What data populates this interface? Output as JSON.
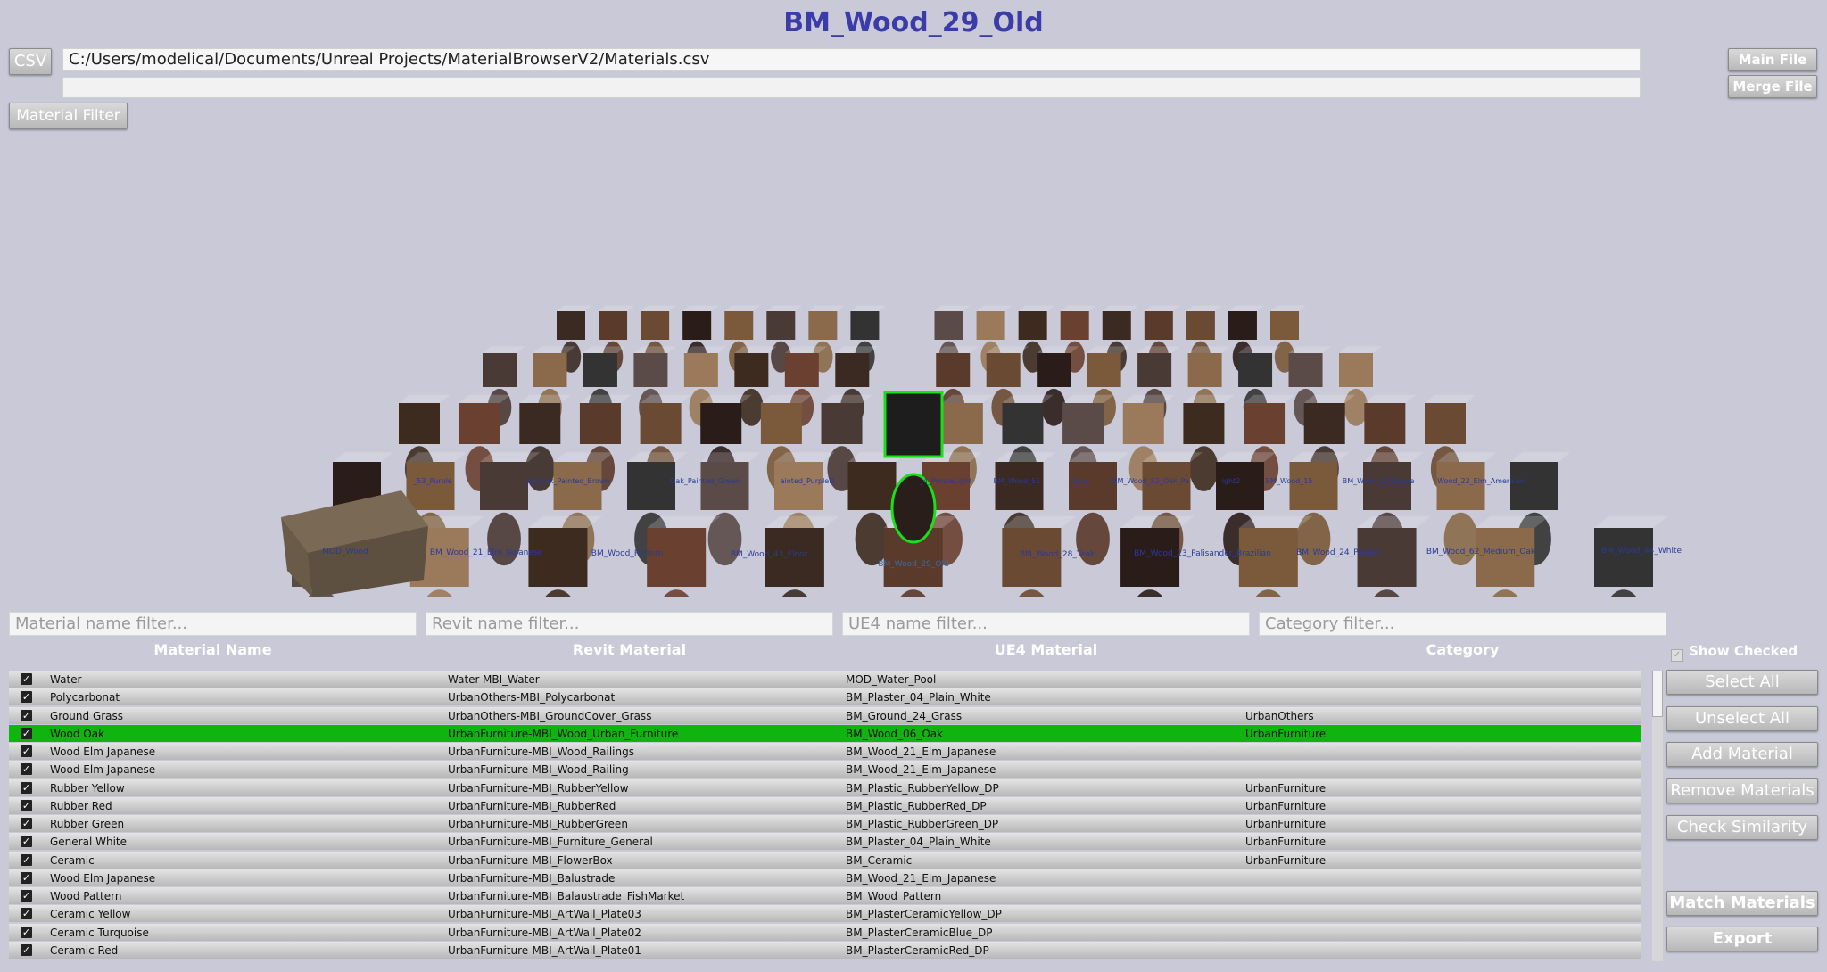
{
  "header": {
    "title": "BM_Wood_29_Old"
  },
  "top": {
    "csv_label": "CSV",
    "csv_path": "C:/Users/modelical/Documents/Unreal Projects/MaterialBrowserV2/Materials.csv",
    "main_file": "Main File",
    "merge_file": "Merge File",
    "material_filter": "Material Filter"
  },
  "viewport": {
    "labels": [
      "MOD_Wood",
      "BM_Wood_21_Elm_Japanese",
      "BM_Wood_Pattern",
      "BM_Wood_43_Floor",
      "BM_Wood_29_Old",
      "BM_Wood_28_Teak",
      "BM_Wood_23_Palisander_Brazilian",
      "BM_Wood_24_Paldao",
      "BM_Wood_62_Medium_Oak",
      "BM_Wood_44_White"
    ],
    "labels_row2": [
      "_53_Purple",
      "_50_Oak_Painted_Brown",
      "Oak_Painted_Green",
      "ainted_PurpleD",
      "_4_PurpleLight",
      "BM_Wood_51",
      "_Blue",
      "BM_Wood_52_Oak_Pa",
      "ight2",
      "BM_Wood_15",
      "BM_Wood_12_Bosse",
      "Wood_22_Elm_American"
    ],
    "selected_label": "BM_Wood_29_Old"
  },
  "filters": {
    "material_placeholder": "Material name filter...",
    "revit_placeholder": "Revit name filter...",
    "ue4_placeholder": "UE4 name filter...",
    "category_placeholder": "Category filter..."
  },
  "columns": {
    "material": "Material Name",
    "revit": "Revit Material",
    "ue4": "UE4 Material",
    "category": "Category"
  },
  "show_checked": "Show Checked",
  "rows": [
    {
      "name": "Water",
      "revit": "Water-MBI_Water",
      "ue4": "MOD_Water_Pool",
      "category": ""
    },
    {
      "name": "Polycarbonat",
      "revit": "UrbanOthers-MBI_Polycarbonat",
      "ue4": "BM_Plaster_04_Plain_White",
      "category": ""
    },
    {
      "name": "Ground Grass",
      "revit": "UrbanOthers-MBI_GroundCover_Grass",
      "ue4": "BM_Ground_24_Grass",
      "category": "UrbanOthers"
    },
    {
      "name": "Wood Oak",
      "revit": "UrbanFurniture-MBI_Wood_Urban_Furniture",
      "ue4": "BM_Wood_06_Oak",
      "category": "UrbanFurniture"
    },
    {
      "name": "Wood Elm Japanese",
      "revit": "UrbanFurniture-MBI_Wood_Railings",
      "ue4": "BM_Wood_21_Elm_Japanese",
      "category": ""
    },
    {
      "name": "Wood Elm Japanese",
      "revit": "UrbanFurniture-MBI_Wood_Railing",
      "ue4": "BM_Wood_21_Elm_Japanese",
      "category": ""
    },
    {
      "name": "Rubber Yellow",
      "revit": "UrbanFurniture-MBI_RubberYellow",
      "ue4": "BM_Plastic_RubberYellow_DP",
      "category": "UrbanFurniture"
    },
    {
      "name": "Rubber Red",
      "revit": "UrbanFurniture-MBI_RubberRed",
      "ue4": "BM_Plastic_RubberRed_DP",
      "category": "UrbanFurniture"
    },
    {
      "name": "Rubber Green",
      "revit": "UrbanFurniture-MBI_RubberGreen",
      "ue4": "BM_Plastic_RubberGreen_DP",
      "category": "UrbanFurniture"
    },
    {
      "name": "General White",
      "revit": "UrbanFurniture-MBI_Furniture_General",
      "ue4": "BM_Plaster_04_Plain_White",
      "category": "UrbanFurniture"
    },
    {
      "name": "Ceramic",
      "revit": "UrbanFurniture-MBI_FlowerBox",
      "ue4": "BM_Ceramic",
      "category": "UrbanFurniture"
    },
    {
      "name": "Wood Elm Japanese",
      "revit": "UrbanFurniture-MBI_Balustrade",
      "ue4": "BM_Wood_21_Elm_Japanese",
      "category": ""
    },
    {
      "name": "Wood Pattern",
      "revit": "UrbanFurniture-MBI_Balaustrade_FishMarket",
      "ue4": "BM_Wood_Pattern",
      "category": ""
    },
    {
      "name": "Ceramic Yellow",
      "revit": "UrbanFurniture-MBI_ArtWall_Plate03",
      "ue4": "BM_PlasterCeramicYellow_DP",
      "category": ""
    },
    {
      "name": "Ceramic Turquoise",
      "revit": "UrbanFurniture-MBI_ArtWall_Plate02",
      "ue4": "BM_PlasterCeramicBlue_DP",
      "category": ""
    },
    {
      "name": "Ceramic Red",
      "revit": "UrbanFurniture-MBI_ArtWall_Plate01",
      "ue4": "BM_PlasterCeramicRed_DP",
      "category": ""
    }
  ],
  "selected_row": 3,
  "side_buttons": {
    "select_all": "Select All",
    "unselect_all": "Unselect All",
    "add_material": "Add Material",
    "remove_materials": "Remove Materials",
    "check_similarity": "Check Similarity",
    "match_materials": "Match Materials",
    "export": "Export"
  },
  "colors": {
    "title": "#3c3ca8",
    "selected_row": "#0fb40f",
    "background": "#c9c9d8"
  }
}
